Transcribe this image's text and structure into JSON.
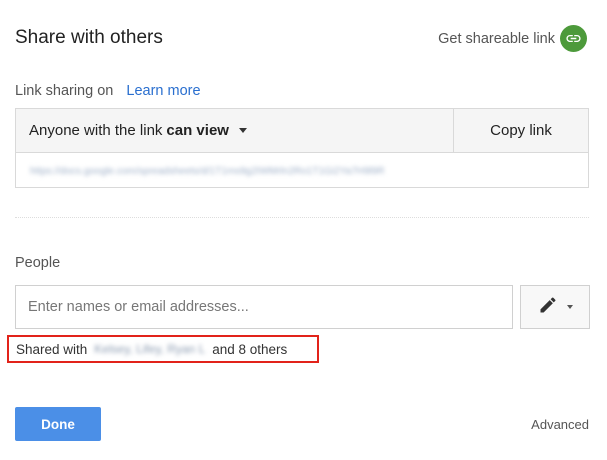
{
  "dialog": {
    "title": "Share with others",
    "get_link_label": "Get shareable link",
    "accent_color": "#4d9a3b"
  },
  "link_sharing": {
    "status": "Link sharing on",
    "learn_more": "Learn more",
    "access_prefix": "Anyone with the link",
    "access_level": "can view",
    "copy_link": "Copy link",
    "url": "https://docs.google.com/spreadsheets/d/1T1ms9g2IWMrln2Ro1T1Gi2Ya7H9l9R"
  },
  "people": {
    "label": "People",
    "input_placeholder": "Enter names or email addresses...",
    "shared_with_prefix": "Shared with",
    "shared_names": "Kelsey, Lifey, Ryan L",
    "shared_suffix": "and 8 others"
  },
  "footer": {
    "done": "Done",
    "advanced": "Advanced",
    "done_color": "#4b8fe7"
  }
}
